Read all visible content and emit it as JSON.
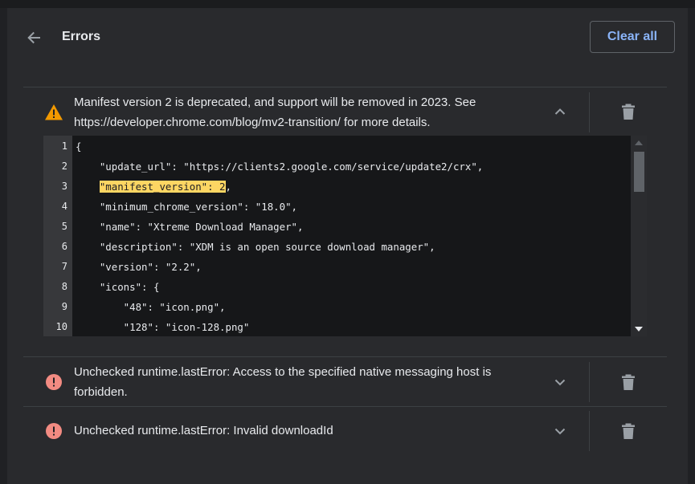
{
  "header": {
    "title": "Errors",
    "clear_all_label": "Clear all"
  },
  "errors": [
    {
      "severity": "warning",
      "icon": "warning-icon",
      "message": "Manifest version 2 is deprecated, and support will be removed in 2023. See https://developer.chrome.com/blog/mv2-transition/ for more details.",
      "expanded": true
    },
    {
      "severity": "error",
      "icon": "error-icon",
      "message": "Unchecked runtime.lastError: Access to the specified native messaging host is forbidden.",
      "expanded": false
    },
    {
      "severity": "error",
      "icon": "error-icon",
      "message": "Unchecked runtime.lastError: Invalid downloadId",
      "expanded": false
    }
  ],
  "code": {
    "lines": [
      {
        "n": "1",
        "pre": "{",
        "hl": "",
        "post": ""
      },
      {
        "n": "2",
        "pre": "    \"update_url\": \"https://clients2.google.com/service/update2/crx\",",
        "hl": "",
        "post": ""
      },
      {
        "n": "3",
        "pre": "    ",
        "hl": "\"manifest_version\": 2",
        "post": ","
      },
      {
        "n": "4",
        "pre": "    \"minimum_chrome_version\": \"18.0\",",
        "hl": "",
        "post": ""
      },
      {
        "n": "5",
        "pre": "    \"name\": \"Xtreme Download Manager\",",
        "hl": "",
        "post": ""
      },
      {
        "n": "6",
        "pre": "    \"description\": \"XDM is an open source download manager\",",
        "hl": "",
        "post": ""
      },
      {
        "n": "7",
        "pre": "    \"version\": \"2.2\",",
        "hl": "",
        "post": ""
      },
      {
        "n": "8",
        "pre": "    \"icons\": {",
        "hl": "",
        "post": ""
      },
      {
        "n": "9",
        "pre": "        \"48\": \"icon.png\",",
        "hl": "",
        "post": ""
      },
      {
        "n": "10",
        "pre": "        \"128\": \"icon-128.png\"",
        "hl": "",
        "post": ""
      }
    ]
  },
  "colors": {
    "accent": "#8ab4f8",
    "warning": "#f29900",
    "error": "#f28b82",
    "highlight": "#fdd663"
  }
}
